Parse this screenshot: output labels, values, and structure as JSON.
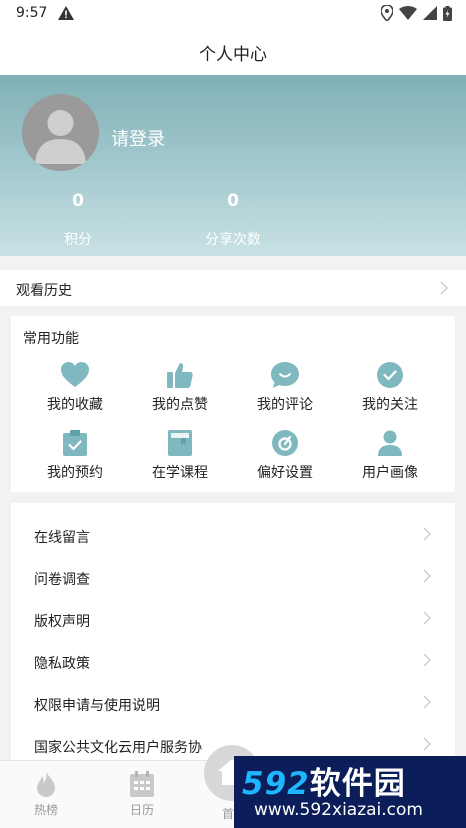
{
  "status_bar": {
    "time": "9:57"
  },
  "header": {
    "title": "个人中心"
  },
  "profile": {
    "login_prompt": "请登录",
    "stats": [
      {
        "value": "0",
        "label": "积分"
      },
      {
        "value": "0",
        "label": "分享次数"
      }
    ]
  },
  "history": {
    "label": "观看历史"
  },
  "functions": {
    "title": "常用功能",
    "items": [
      {
        "label": "我的收藏",
        "icon": "heart-icon"
      },
      {
        "label": "我的点赞",
        "icon": "thumbs-up-icon"
      },
      {
        "label": "我的评论",
        "icon": "chat-bubble-icon"
      },
      {
        "label": "我的关注",
        "icon": "check-circle-icon"
      },
      {
        "label": "我的预约",
        "icon": "clipboard-check-icon"
      },
      {
        "label": "在学课程",
        "icon": "book-icon"
      },
      {
        "label": "偏好设置",
        "icon": "gauge-icon"
      },
      {
        "label": "用户画像",
        "icon": "user-icon"
      }
    ],
    "accent_color": "#7fb8be"
  },
  "menu": {
    "items": [
      {
        "label": "在线留言"
      },
      {
        "label": "问卷调查"
      },
      {
        "label": "版权声明"
      },
      {
        "label": "隐私政策"
      },
      {
        "label": "权限申请与使用说明"
      },
      {
        "label": "国家公共文化云用户服务协"
      }
    ]
  },
  "bottom_nav": {
    "items": [
      {
        "label": "热榜",
        "icon": "flame-icon"
      },
      {
        "label": "日历",
        "icon": "calendar-icon"
      },
      {
        "label": "首",
        "icon": "home-icon"
      }
    ]
  },
  "watermark": {
    "brand_num": "592",
    "brand_text": "软件园",
    "url": "www.592xiazai.com"
  }
}
